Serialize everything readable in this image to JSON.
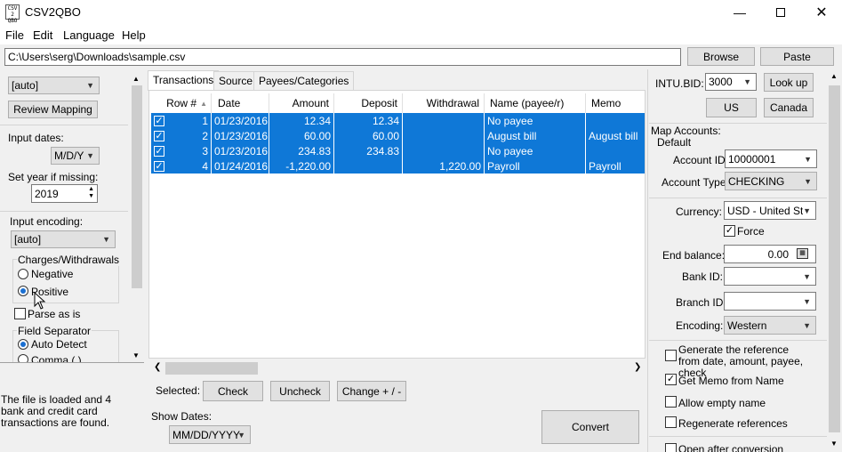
{
  "window": {
    "title": "CSV2QBO",
    "icon_text": "CSV 2 QBO"
  },
  "menu": [
    "File",
    "Edit",
    "Language",
    "Help"
  ],
  "file": {
    "path": "C:\\Users\\serg\\Downloads\\sample.csv",
    "browse": "Browse",
    "paste": "Paste"
  },
  "left": {
    "mapping_select": "[auto]",
    "review_mapping": "Review Mapping",
    "input_dates_label": "Input dates:",
    "date_format": "M/D/Y",
    "year_label": "Set year if missing:",
    "year_value": "2019",
    "encoding_label": "Input encoding:",
    "encoding_value": "[auto]",
    "charges_title": "Charges/Withdrawals",
    "negative": "Negative",
    "positive": "Positive",
    "parse_as_is": "Parse as is",
    "separator_title": "Field Separator",
    "auto_detect": "Auto Detect",
    "comma": "Comma (,)",
    "status": "The file is loaded and 4 bank and credit card transactions are found."
  },
  "tabs": [
    "Transactions",
    "Source",
    "Payees/Categories"
  ],
  "table": {
    "headers": [
      "Row #",
      "Date",
      "Amount",
      "Deposit",
      "Withdrawal",
      "Name (payee/r)",
      "Memo"
    ],
    "rows": [
      {
        "row": "1",
        "date": "01/23/2016",
        "amount": "12.34",
        "deposit": "12.34",
        "withdrawal": "",
        "name": "No payee",
        "memo": ""
      },
      {
        "row": "2",
        "date": "01/23/2016",
        "amount": "60.00",
        "deposit": "60.00",
        "withdrawal": "",
        "name": "August bill",
        "memo": "August bill"
      },
      {
        "row": "3",
        "date": "01/23/2016",
        "amount": "234.83",
        "deposit": "234.83",
        "withdrawal": "",
        "name": "No payee",
        "memo": ""
      },
      {
        "row": "4",
        "date": "01/24/2016",
        "amount": "-1,220.00",
        "deposit": "",
        "withdrawal": "1,220.00",
        "name": "Payroll",
        "memo": "Payroll"
      }
    ]
  },
  "bottom": {
    "selected_label": "Selected:",
    "check": "Check",
    "uncheck": "Uncheck",
    "change": "Change + / -",
    "show_dates_label": "Show Dates:",
    "show_dates_value": "MM/DD/YYYY",
    "convert": "Convert"
  },
  "right": {
    "intu_bid_label": "INTU.BID:",
    "intu_bid_value": "3000",
    "look_up": "Look up",
    "us": "US",
    "canada": "Canada",
    "map_accounts": "Map Accounts:",
    "default": "Default",
    "account_id_label": "Account ID:",
    "account_id_value": "10000001",
    "account_type_label": "Account Type:",
    "account_type_value": "CHECKING",
    "currency_label": "Currency:",
    "currency_value": "USD - United Sta",
    "force": "Force",
    "end_balance_label": "End balance:",
    "end_balance_value": "0.00",
    "bank_id_label": "Bank ID:",
    "branch_id_label": "Branch ID",
    "encoding_label": "Encoding:",
    "encoding_value": "Western",
    "gen_ref": "Generate the reference from date, amount, payee, check",
    "memo_from_name": "Get Memo from Name",
    "allow_empty": "Allow empty name",
    "regen_ref": "Regenerate references",
    "open_after": "Open after conversion"
  }
}
